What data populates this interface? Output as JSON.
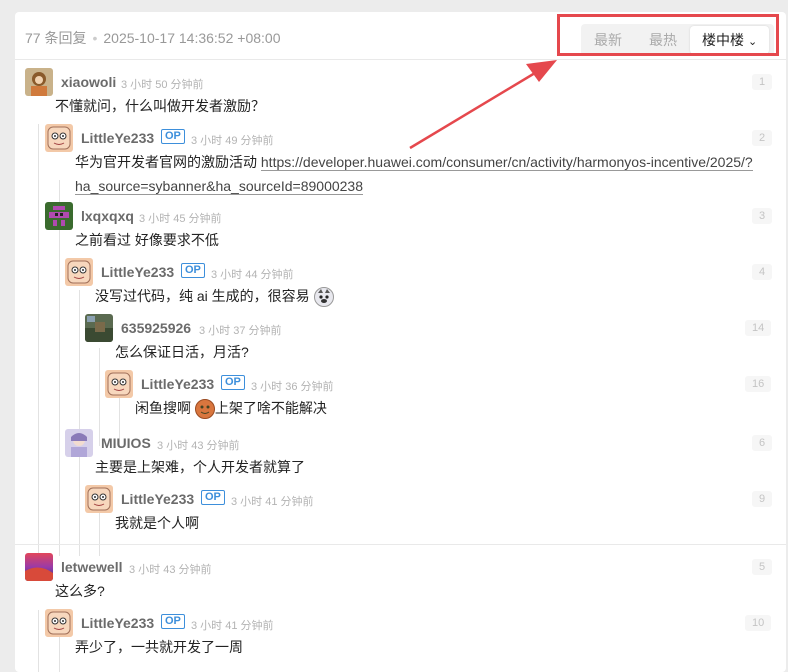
{
  "header": {
    "reply_count": "77 条回复",
    "date": "2025-10-17 14:36:52 +08:00",
    "sort_tabs": [
      "最新",
      "最热",
      "楼中楼"
    ]
  },
  "op_badge": "OP",
  "replies": [
    {
      "user": "xiaowoli",
      "time": "3 小时 50 分钟前",
      "floor": "1",
      "content": "不懂就问，什么叫做开发者激励？"
    },
    {
      "user": "LittleYe233",
      "time": "3 小时 49 分钟前",
      "floor": "2",
      "content": "华为官开发者官网的激励活动",
      "link_line1": "https://developer.huawei.com/consumer/cn/activity/harmonyos-incentive/2025/?",
      "link_line2": "ha_source=sybanner&ha_sourceId=89000238"
    },
    {
      "user": "lxqxqxq",
      "time": "3 小时 45 分钟前",
      "floor": "3",
      "content": "之前看过 好像要求不低"
    },
    {
      "user": "LittleYe233",
      "time": "3 小时 44 分钟前",
      "floor": "4",
      "content": "没写过代码，纯 ai 生成的，很容易"
    },
    {
      "user": "635925926",
      "time": "3 小时 37 分钟前",
      "floor": "14",
      "content": "怎么保证日活，月活?"
    },
    {
      "user": "LittleYe233",
      "time": "3 小时 36 分钟前",
      "floor": "16",
      "content_a": "闲鱼搜啊",
      "content_b": "上架了啥不能解决"
    },
    {
      "user": "MIUIOS",
      "time": "3 小时 43 分钟前",
      "floor": "6",
      "content": "主要是上架难，个人开发者就算了"
    },
    {
      "user": "LittleYe233",
      "time": "3 小时 41 分钟前",
      "floor": "9",
      "content": "我就是个人啊"
    },
    {
      "user": "letwewell",
      "time": "3 小时 43 分钟前",
      "floor": "5",
      "content": "这么多?"
    },
    {
      "user": "LittleYe233",
      "time": "3 小时 41 分钟前",
      "floor": "10",
      "content": "弄少了，一共就开发了一周"
    }
  ],
  "colors": {
    "annotation": "#e5484d",
    "op_badge": "#3d8fdb",
    "username": "#6b6b6b"
  }
}
